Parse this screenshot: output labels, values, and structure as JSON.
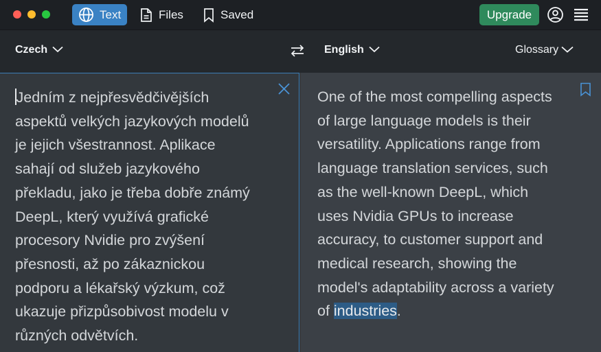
{
  "topbar": {
    "tabs": [
      {
        "label": "Text",
        "icon": "globe-icon",
        "active": true
      },
      {
        "label": "Files",
        "icon": "document-icon",
        "active": false
      },
      {
        "label": "Saved",
        "icon": "bookmark-icon",
        "active": false
      }
    ],
    "upgrade_label": "Upgrade",
    "account_icon": "account-icon",
    "menu_icon": "hamburger-menu-icon"
  },
  "languages": {
    "source": "Czech",
    "target": "English",
    "glossary_label": "Glossary",
    "swap_icon": "swap-arrows-icon"
  },
  "source": {
    "text_before_caret": "",
    "text": "Jedním z nejpřesvědčivějších\naspektů velkých jazykových modelů\nje jejich všestrannost. Aplikace\nsahají od služeb jazykového\npřekladu, jako je třeba dobře známý\nDeepL, který využívá grafické\nprocesory Nvidie pro zvýšení\npřesnosti, až po zákaznickou\npodporu a lékařský výzkum, což\nukazuje přizpůsobivost modelu v\nrůzných odvětvích."
  },
  "target": {
    "text_before": "One of the most compelling aspects\nof large language models is their\nversatility. Applications range from\nlanguage translation services, such\nas the well-known DeepL, which\nuses Nvidia GPUs to increase\naccuracy, to customer support and\nmedical research, showing the\nmodel's adaptability across a variety\nof ",
    "highlighted": "industries",
    "text_after": "."
  },
  "colors": {
    "accent": "#3a82c4",
    "upgrade": "#2f8a5c",
    "highlight": "#2d5c86"
  }
}
